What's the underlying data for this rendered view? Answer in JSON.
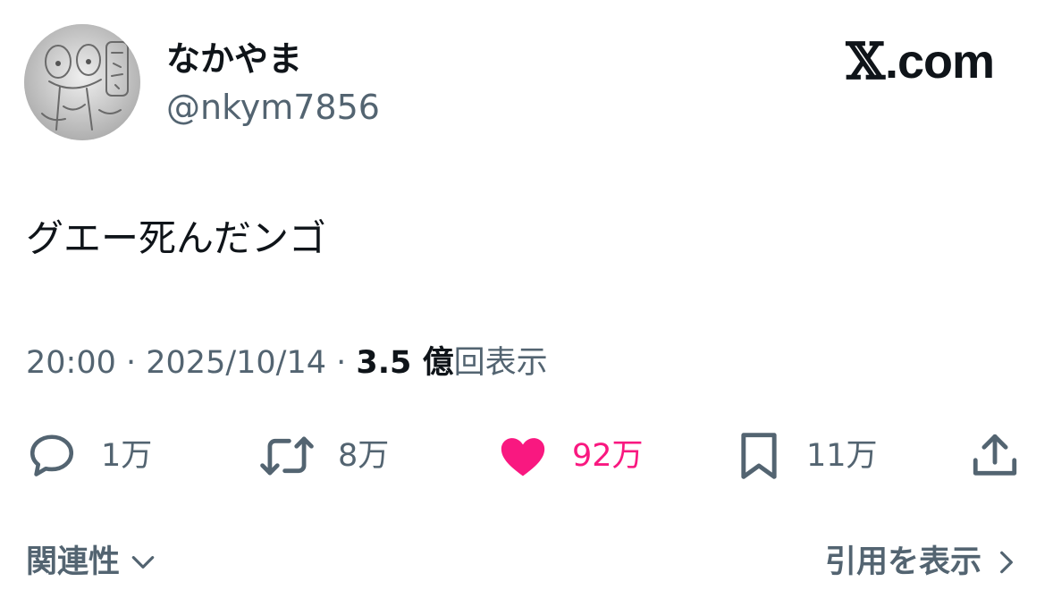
{
  "author": {
    "display_name": "なかやま",
    "handle": "@nkym7856",
    "avatar_icon": "avatar-sketch"
  },
  "brand": {
    "x_mark": "𝕏",
    "text": ".com"
  },
  "tweet": {
    "text": "グエー死んだンゴ"
  },
  "meta": {
    "time": "20:00",
    "sep1": " · ",
    "date": "2025/10/14",
    "sep2": " · ",
    "views_count": "3.5 億",
    "views_label": "回表示"
  },
  "actions": {
    "reply": {
      "icon": "reply-icon",
      "count": "1万"
    },
    "retweet": {
      "icon": "retweet-icon",
      "count": "8万"
    },
    "like": {
      "icon": "heart-icon",
      "count": "92万",
      "active": true,
      "color": "#f91880"
    },
    "bookmark": {
      "icon": "bookmark-icon",
      "count": "11万"
    },
    "share": {
      "icon": "share-icon"
    }
  },
  "footer": {
    "related_label": "関連性",
    "quotes_label": "引用を表示"
  },
  "colors": {
    "primary_text": "#0f1419",
    "secondary_text": "#536471",
    "like": "#f91880"
  }
}
